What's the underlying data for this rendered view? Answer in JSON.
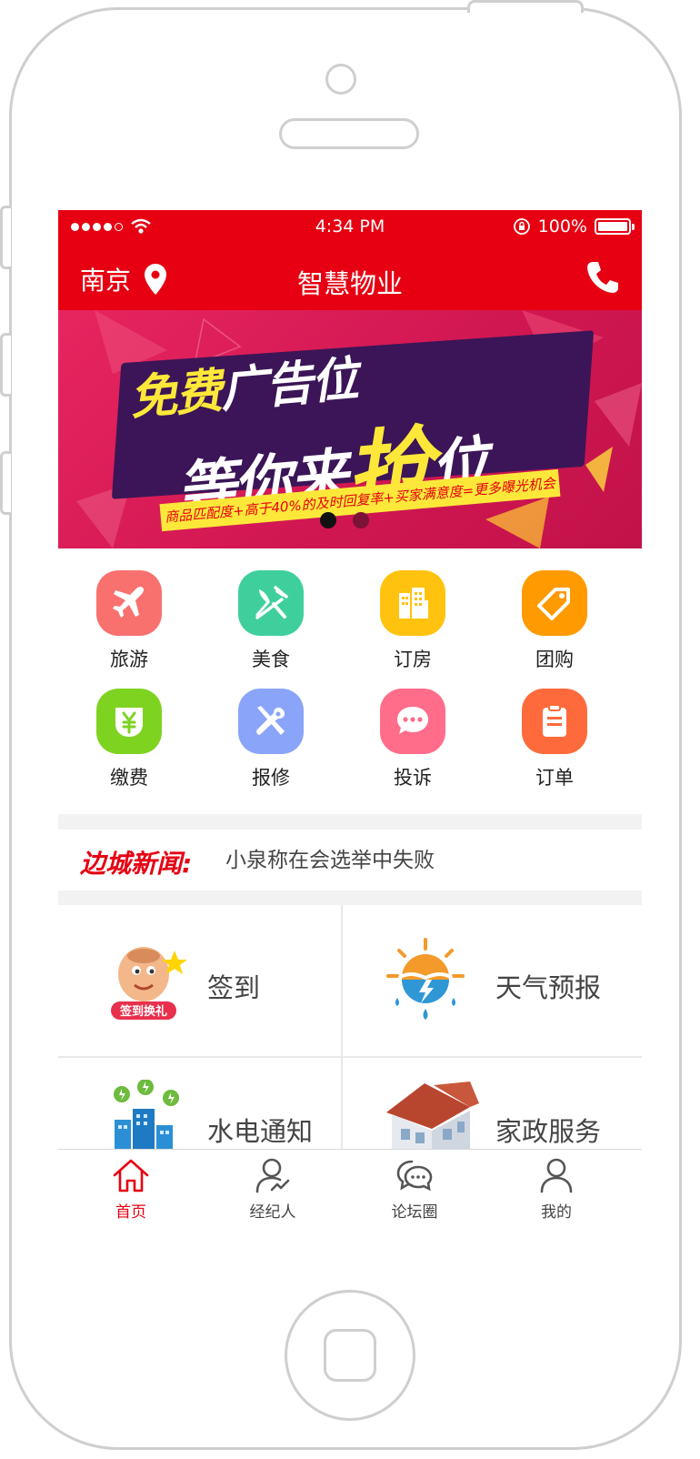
{
  "status_bar": {
    "time": "4:34 PM",
    "battery": "100%",
    "signal_dots": 5,
    "signal_filled": 4
  },
  "nav": {
    "city": "南京",
    "title": "智慧物业"
  },
  "banner": {
    "line1_highlight": "免费",
    "line1_rest": "广告位",
    "line2_a": "等你来",
    "line2_big": "抢",
    "line2_b": "位",
    "strip": "商品匹配度+高于40%的及时回复率+买家满意度=更多曝光机会",
    "page_count": 2,
    "active_page": 0
  },
  "services": [
    {
      "label": "旅游",
      "icon": "airplane-icon",
      "color": "#f8716f"
    },
    {
      "label": "美食",
      "icon": "fork-knife-icon",
      "color": "#3fcf9d"
    },
    {
      "label": "订房",
      "icon": "building-icon",
      "color": "#ffc20f"
    },
    {
      "label": "团购",
      "icon": "tag-icon",
      "color": "#ff9a00"
    },
    {
      "label": "缴费",
      "icon": "yen-icon",
      "color": "#7ed321"
    },
    {
      "label": "报修",
      "icon": "tools-icon",
      "color": "#8aa4f9"
    },
    {
      "label": "投诉",
      "icon": "chat-icon",
      "color": "#ff6d8a"
    },
    {
      "label": "订单",
      "icon": "clipboard-icon",
      "color": "#ff6a3c"
    }
  ],
  "news": {
    "tag": "边城新闻:",
    "headline": "小泉称在会选举中失败"
  },
  "cards": [
    {
      "label": "签到",
      "pic": "checkin-mascot",
      "badge": "签到换礼"
    },
    {
      "label": "天气预报",
      "pic": "weather-icon"
    },
    {
      "label": "水电通知",
      "pic": "utility-buildings"
    },
    {
      "label": "家政服务",
      "pic": "house-image"
    }
  ],
  "tabs": [
    {
      "label": "首页",
      "icon": "home-icon",
      "active": true
    },
    {
      "label": "经纪人",
      "icon": "agent-icon",
      "active": false
    },
    {
      "label": "论坛圈",
      "icon": "forum-icon",
      "active": false
    },
    {
      "label": "我的",
      "icon": "profile-icon",
      "active": false
    }
  ],
  "colors": {
    "brand_red": "#e60012",
    "banner_pink": "#d11752",
    "banner_yellow": "#fde83a"
  }
}
